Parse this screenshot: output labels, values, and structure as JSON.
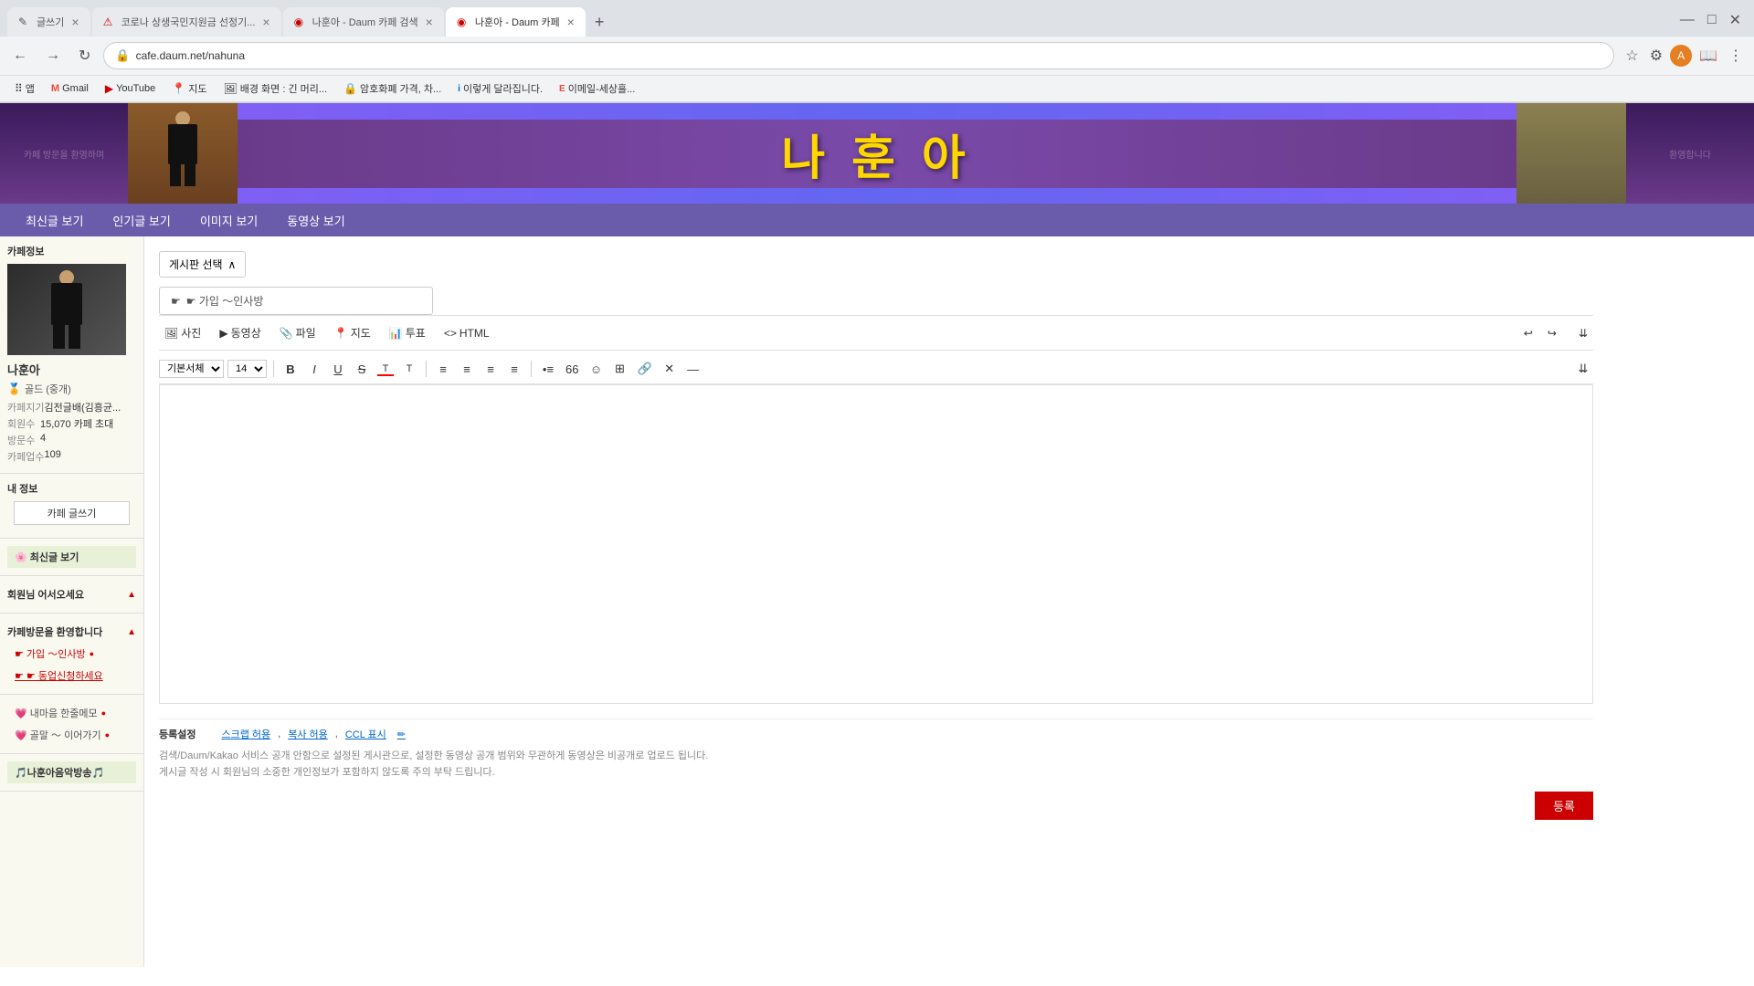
{
  "browser": {
    "tabs": [
      {
        "id": "tab1",
        "title": "글쓰기",
        "favicon": "✎",
        "active": false,
        "color": "#555"
      },
      {
        "id": "tab2",
        "title": "코로나 상생국민지원금 선정기...",
        "favicon": "⚠",
        "active": false,
        "color": "#c00"
      },
      {
        "id": "tab3",
        "title": "나훈아 - Daum 카페 검색",
        "favicon": "◉",
        "active": false,
        "color": "#c00"
      },
      {
        "id": "tab4",
        "title": "나훈아 - Daum 카페",
        "favicon": "◉",
        "active": true,
        "color": "#c00"
      }
    ],
    "address": "cafe.daum.net/nahuna",
    "lock_icon": "🔒"
  },
  "bookmarks": [
    {
      "label": "앱",
      "icon": "⠿"
    },
    {
      "label": "Gmail",
      "icon": "M"
    },
    {
      "label": "YouTube",
      "icon": "▶"
    },
    {
      "label": "지도",
      "icon": "📍"
    },
    {
      "label": "배경 화면 : 긴 머리...",
      "icon": "🖼"
    },
    {
      "label": "암호화폐 가격, 차...",
      "icon": "🔒"
    },
    {
      "label": "이렇게 달라집니다.",
      "icon": "i"
    },
    {
      "label": "이메일-세상흘...",
      "icon": "E"
    }
  ],
  "cafe": {
    "banner_title": "나 훈 아",
    "nav_items": [
      "최신글 보기",
      "인기글 보기",
      "이미지 보기",
      "동영상 보기"
    ]
  },
  "sidebar": {
    "section_title": "카페정보",
    "cafe_name": "나훈아",
    "level_label": "골드 (중개)",
    "info": [
      {
        "label": "카페지기",
        "value": "김전글배(김흥균..."
      },
      {
        "label": "회원수",
        "value": "15,070  카페 초대"
      },
      {
        "label": "방문수",
        "value": "4"
      },
      {
        "label": "카페업수",
        "value": "109"
      }
    ],
    "my_info_label": "내 정보",
    "write_btn": "카페 글쓰기",
    "recent_label": "🌸 최신글 보기",
    "members_label": "회원님 어서오세요",
    "welcome_label": "카페방문을 환영합니다",
    "menu_items": [
      {
        "label": "☛ 가입 ～인사방",
        "dot": "●"
      },
      {
        "label": "☛ ☛ 동업신청하세요",
        "dot": ""
      }
    ],
    "sub_items": [
      {
        "label": "💗 내마음 한줄메모",
        "dot": "●"
      },
      {
        "label": "💗 골말 ～ 이어가기",
        "dot": "●"
      }
    ],
    "music_label": "🎵나훈아음악방송🎵"
  },
  "editor": {
    "board_select_label": "게시판 선택",
    "board_name": "☛ 가입 ～인사방",
    "toolbar_items": [
      {
        "label": "사진",
        "icon": "🖼"
      },
      {
        "label": "동영상",
        "icon": "▶"
      },
      {
        "label": "파일",
        "icon": "📎"
      },
      {
        "label": "지도",
        "icon": "📍"
      },
      {
        "label": "투표",
        "icon": "📊"
      },
      {
        "label": "HTML",
        "icon": "<>"
      }
    ],
    "font_select": "기본서체",
    "font_size": "14",
    "format_buttons": [
      "B",
      "I",
      "U",
      "S",
      "To",
      "T"
    ],
    "align_buttons": [
      "≡",
      "≡",
      "≡",
      "≡"
    ],
    "other_buttons": [
      "•≡",
      "66",
      "☺",
      "⊞",
      "🔗",
      "✕",
      "—"
    ],
    "undo_label": "↩",
    "redo_label": "↪"
  },
  "footer": {
    "settings_label": "등록설정",
    "scrap_label": "스크랩 허용",
    "copy_label": "복사 허용",
    "ccl_label": "CCL 표시",
    "edit_icon": "✏",
    "notice1": "검색/Daum/Kakao 서비스 공개 안함으로 설정된 게시관으로, 설정한 동영상 공개 범위와 무관하게 동영상은 비공개로 업로드 됩니다.",
    "notice2": "게시글 작성 시 회원님의 소중한 개인정보가 포함하지 않도록 주의 부탁 드립니다."
  }
}
